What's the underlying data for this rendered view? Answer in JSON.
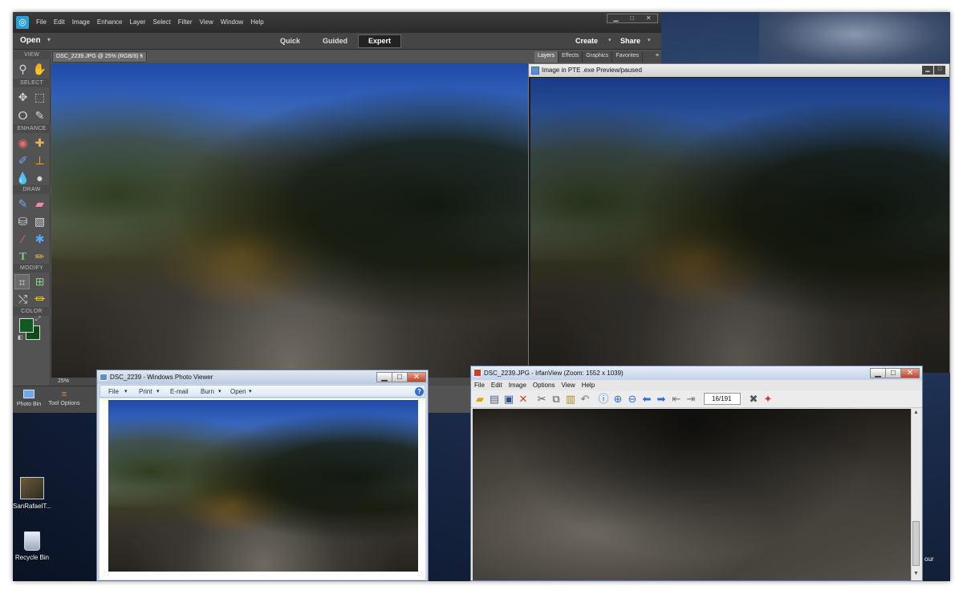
{
  "pse": {
    "menu": [
      "File",
      "Edit",
      "Image",
      "Enhance",
      "Layer",
      "Select",
      "Filter",
      "View",
      "Window",
      "Help"
    ],
    "open_label": "Open",
    "modes": {
      "quick": "Quick",
      "guided": "Guided",
      "expert": "Expert"
    },
    "create_label": "Create",
    "share_label": "Share",
    "doc_tab": "DSC_2239.JPG @ 25% (RGB/8) *",
    "close_glyph": "×",
    "panel_tabs": [
      "Layers",
      "Effects",
      "Graphics",
      "Favorites"
    ],
    "sections": {
      "view": "VIEW",
      "select": "SELECT",
      "enhance": "ENHANCE",
      "draw": "DRAW",
      "modify": "MODIFY",
      "color": "COLOR"
    },
    "zoom": "25%",
    "bottom": {
      "photo_bin": "Photo Bin",
      "tool_options": "Tool Options"
    },
    "colors": {
      "foreground": "#0f5a1e",
      "background": "#0b4d18"
    }
  },
  "pte": {
    "title": "Image in PTE .exe Preview/paused"
  },
  "wpv": {
    "title": "DSC_2239 - Windows Photo Viewer",
    "menu": [
      {
        "label": "File"
      },
      {
        "label": "Print"
      },
      {
        "label": "E-mail"
      },
      {
        "label": "Burn"
      },
      {
        "label": "Open"
      }
    ],
    "help_glyph": "?"
  },
  "irfan": {
    "title": "DSC_2239.JPG - IrfanView (Zoom: 1552 x 1039)",
    "menu": [
      "File",
      "Edit",
      "Image",
      "Options",
      "View",
      "Help"
    ],
    "page_counter": "16/191"
  },
  "desktop": {
    "icons": [
      {
        "label": "SanRafaelT..."
      },
      {
        "label": "Recycle Bin"
      }
    ],
    "edge_label": "our"
  },
  "window_glyphs": {
    "min": "▁",
    "max": "□",
    "close": "✕"
  }
}
